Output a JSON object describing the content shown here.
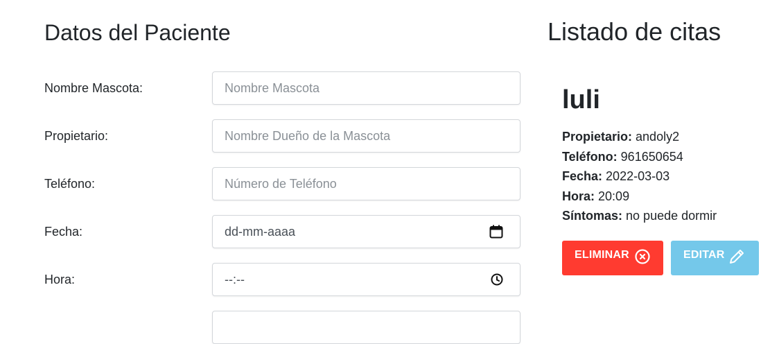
{
  "form": {
    "title": "Datos del Paciente",
    "fields": [
      {
        "label": "Nombre Mascota:",
        "placeholder": "Nombre Mascota",
        "value": "",
        "icon": ""
      },
      {
        "label": "Propietario:",
        "placeholder": "Nombre Dueño de la Mascota",
        "value": "",
        "icon": ""
      },
      {
        "label": "Teléfono:",
        "placeholder": "Número de Teléfono",
        "value": "",
        "icon": ""
      },
      {
        "label": "Fecha:",
        "placeholder": "dd-mm-aaaa",
        "value": "",
        "icon": "calendar-icon"
      },
      {
        "label": "Hora:",
        "placeholder": "--:--",
        "value": "",
        "icon": "clock-icon"
      }
    ]
  },
  "list": {
    "title": "Listado de citas",
    "appointments": [
      {
        "name": "luli",
        "owner_label": "Propietario:",
        "owner": "andoly2",
        "phone_label": "Teléfono:",
        "phone": "961650654",
        "date_label": "Fecha:",
        "date": "2022-03-03",
        "time_label": "Hora:",
        "time": "20:09",
        "symptoms_label": "Síntomas:",
        "symptoms": "no puede dormir",
        "delete_label": "ELIMINAR",
        "edit_label": "EDITAR"
      }
    ]
  },
  "colors": {
    "delete_button": "#ff3b30",
    "edit_button": "#74c8ea",
    "text": "#212529"
  }
}
